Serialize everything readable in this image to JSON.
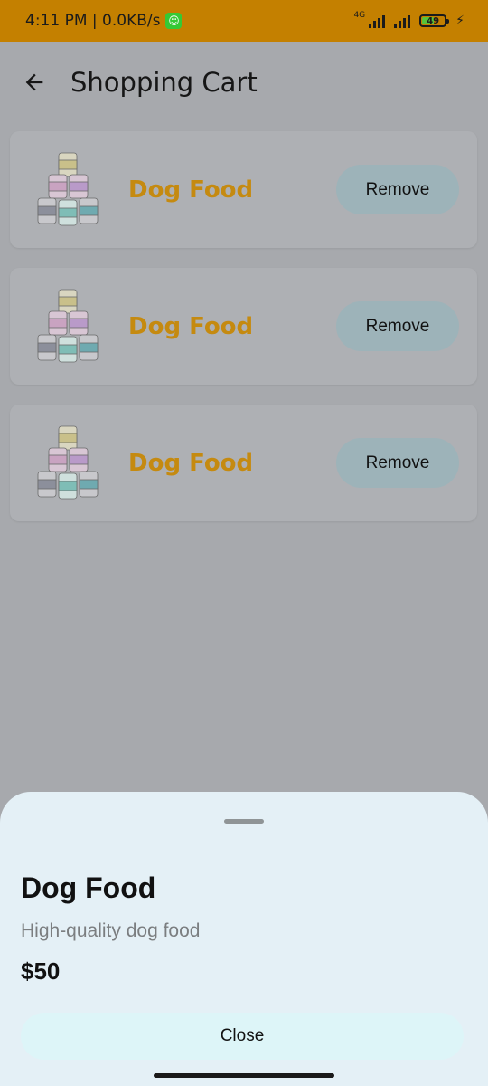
{
  "status_bar": {
    "time_speed": "4:11 PM | 0.0KB/s",
    "network_type": "4G",
    "battery_level": "49",
    "battery_color": "#56c43a",
    "bar_color": "#c48000"
  },
  "app_bar": {
    "back_icon": "arrow-left-icon",
    "title": "Shopping Cart"
  },
  "cart": {
    "items": [
      {
        "name": "Dog Food",
        "remove_label": "Remove",
        "image_icon": "dog-food-cans-icon"
      },
      {
        "name": "Dog Food",
        "remove_label": "Remove",
        "image_icon": "dog-food-cans-icon"
      },
      {
        "name": "Dog Food",
        "remove_label": "Remove",
        "image_icon": "dog-food-cans-icon"
      }
    ],
    "name_color": "#c58a10"
  },
  "sheet": {
    "title": "Dog Food",
    "description": "High-quality dog food",
    "price": "$50",
    "close_label": "Close",
    "background": "#e4f0f6"
  }
}
